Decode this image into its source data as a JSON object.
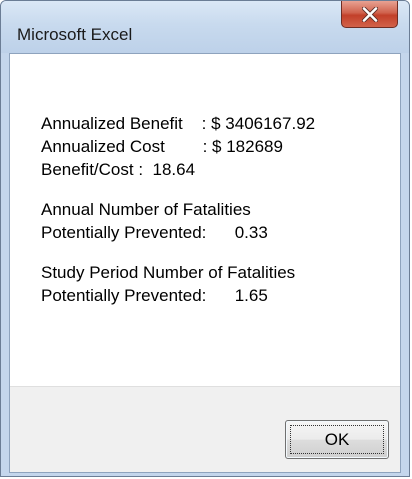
{
  "window": {
    "title": "Microsoft Excel",
    "close_icon": "close-icon"
  },
  "message": {
    "annualized_benefit": "Annualized Benefit    : $ 3406167.92",
    "annualized_cost": "Annualized Cost        : $ 182689",
    "benefit_cost": "Benefit/Cost :  18.64",
    "annual_fatalities_heading": "Annual Number of Fatalities",
    "annual_fatalities_value": "Potentially Prevented:      0.33",
    "study_fatalities_heading": "Study Period Number of Fatalities",
    "study_fatalities_value": "Potentially Prevented:      1.65"
  },
  "buttons": {
    "ok_label": "OK"
  },
  "colors": {
    "close_button": "#c2402a",
    "titlebar": "#c8daee"
  }
}
